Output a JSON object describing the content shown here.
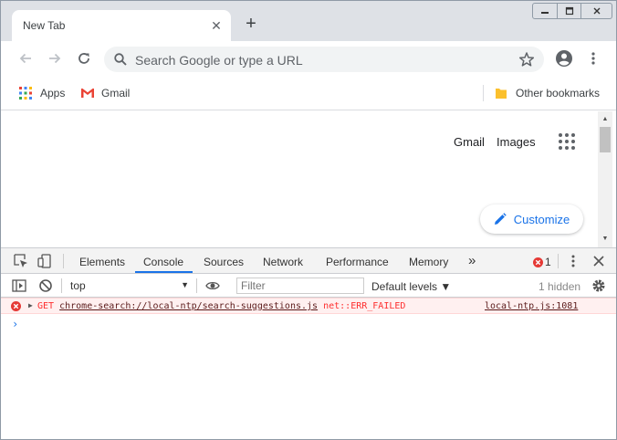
{
  "tab": {
    "title": "New Tab",
    "close": "✕",
    "new_tab": "+"
  },
  "window_controls": {
    "minimize": "▭",
    "maximize": "⧉",
    "close": "✕"
  },
  "omnibox": {
    "placeholder": "Search Google or type a URL"
  },
  "icons": {
    "back": "arrow-left-icon",
    "forward": "arrow-right-icon",
    "reload": "reload-icon",
    "search": "search-icon",
    "star": "star-icon",
    "profile": "profile-icon",
    "menu": "kebab-menu-icon"
  },
  "bookmarks": {
    "apps": "Apps",
    "gmail": "Gmail",
    "other": "Other bookmarks"
  },
  "page": {
    "gmail": "Gmail",
    "images": "Images",
    "customize": "Customize"
  },
  "devtools": {
    "tabs": [
      "Elements",
      "Console",
      "Sources",
      "Network",
      "Performance",
      "Memory"
    ],
    "more": "»",
    "active_tab": "Console",
    "error_count": "1",
    "close": "✕",
    "context": "top",
    "filter_placeholder": "Filter",
    "levels": "Default levels ▼",
    "hidden": "1 hidden",
    "message": {
      "method": "GET",
      "url": "chrome-search://local-ntp/search-suggestions.js",
      "error": "net::ERR_FAILED",
      "source": "local-ntp.js:1081"
    },
    "prompt": "›"
  },
  "colors": {
    "accent": "#1a73e8",
    "error": "#fe2f2f",
    "error_bg": "#fff0f0"
  }
}
